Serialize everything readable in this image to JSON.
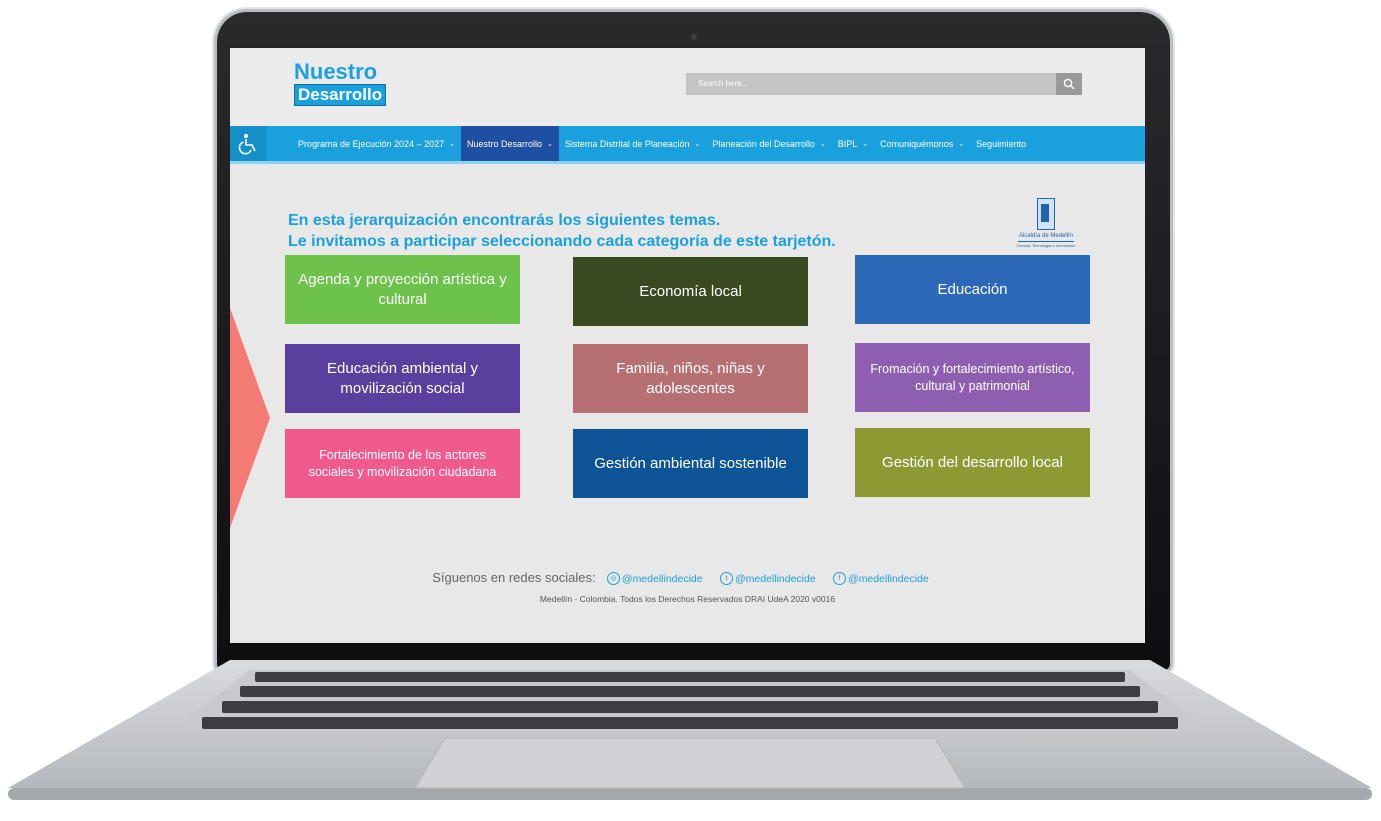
{
  "header": {
    "logo_top": "Nuestro",
    "logo_bottom": "Desarrollo",
    "search_placeholder": "Search here..."
  },
  "nav": {
    "items": [
      {
        "label": "Programa de Ejecución 2024 – 2027",
        "dropdown": true
      },
      {
        "label": "Nuestro Desarrollo",
        "dropdown": true,
        "active": true
      },
      {
        "label": "Sistema Distrital de Planeación",
        "dropdown": true
      },
      {
        "label": "Planeación del Desarrollo",
        "dropdown": true
      },
      {
        "label": "BIPL",
        "dropdown": true
      },
      {
        "label": "Comuniquémonos",
        "dropdown": true
      },
      {
        "label": "Seguimiento",
        "dropdown": false
      }
    ]
  },
  "intro": {
    "line1": "En esta jerarquización encontrarás los siguientes temas.",
    "line2": "Le invitamos a participar seleccionando cada categoría de este tarjetón."
  },
  "alcaldia": {
    "name": "Alcaldía de Medellín",
    "sub": "Ciencia, Tecnología e Innovación"
  },
  "cards": [
    {
      "label": "Agenda y proyección artística y cultural",
      "color": "#6cc24a"
    },
    {
      "label": "Economía local",
      "color": "#3a4a20"
    },
    {
      "label": "Educación",
      "color": "#2c67b8"
    },
    {
      "label": "Educación ambiental y movilización social",
      "color": "#5a3f9e"
    },
    {
      "label": "Familia, niños, niñas y adolescentes",
      "color": "#b66f72"
    },
    {
      "label": "Fromación y fortalecimiento artístico, cultural y patrimonial",
      "color": "#8e5fb0"
    },
    {
      "label": "Fortalecimiento de los actores sociales y movilización ciudadana",
      "color": "#f05a8c"
    },
    {
      "label": "Gestión ambiental sostenible",
      "color": "#0c5496"
    },
    {
      "label": "Gestión del desarrollo local",
      "color": "#8d9a34"
    }
  ],
  "footer": {
    "follow": "Síguenos en redes sociales:",
    "instagram": "@medellindecide",
    "twitter": "@medellindecide",
    "facebook": "@medellindecide",
    "copyright": "Medellín - Colombia. Todos los Derechos Reservados DRAI UdeA 2020 v0016"
  },
  "icons": [
    "accessibility-icon",
    "search-icon",
    "chevron-down-icon",
    "instagram-icon",
    "twitter-icon",
    "facebook-icon"
  ]
}
